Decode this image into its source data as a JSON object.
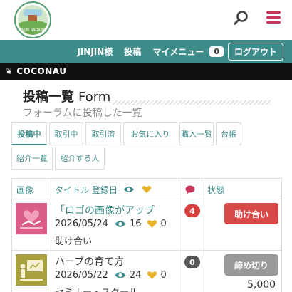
{
  "colors": {
    "teal": "#3e8c8a",
    "crimson": "#c8375b",
    "badge_red": "#d84040",
    "badge_dark": "#555555",
    "btn_red": "#d94848",
    "btn_gray": "#999999",
    "gold": "#e5b22a"
  },
  "header": {
    "logo_text": "JINJIN NAGANO"
  },
  "nav": {
    "user_label": "JINJIN様",
    "post_label": "投稿",
    "mymenu_label": "マイメニュー",
    "mymenu_count": "0",
    "logout_label": "ログアウト"
  },
  "brand": {
    "name": "COCONAU"
  },
  "page": {
    "title": "投稿一覧",
    "title_en": "Form",
    "subtitle": "フォーラムに投稿した一覧"
  },
  "tabs": [
    {
      "label": "投稿中",
      "active": true
    },
    {
      "label": "取引中"
    },
    {
      "label": "取引済"
    },
    {
      "label": "お気に入り"
    },
    {
      "label": "購入一覧"
    },
    {
      "label": "台帳"
    },
    {
      "label": "紹介一覧"
    },
    {
      "label": "紹介する人"
    }
  ],
  "table": {
    "headers": {
      "image": "画像",
      "title": "タイトル 登録日",
      "status": "状態"
    },
    "rows": [
      {
        "title": "「ロゴの画像がアップ",
        "date": "2026/05/24",
        "views": "16",
        "likes": "0",
        "category": "助け合い",
        "messages": "4",
        "status": "助け合い",
        "price": ""
      },
      {
        "title": "ハーブの育て方",
        "date": "2026/05/22",
        "views": "24",
        "likes": "0",
        "category": "セミナー・スクール",
        "messages": "0",
        "status": "締め切り",
        "price": "5,000"
      }
    ]
  }
}
